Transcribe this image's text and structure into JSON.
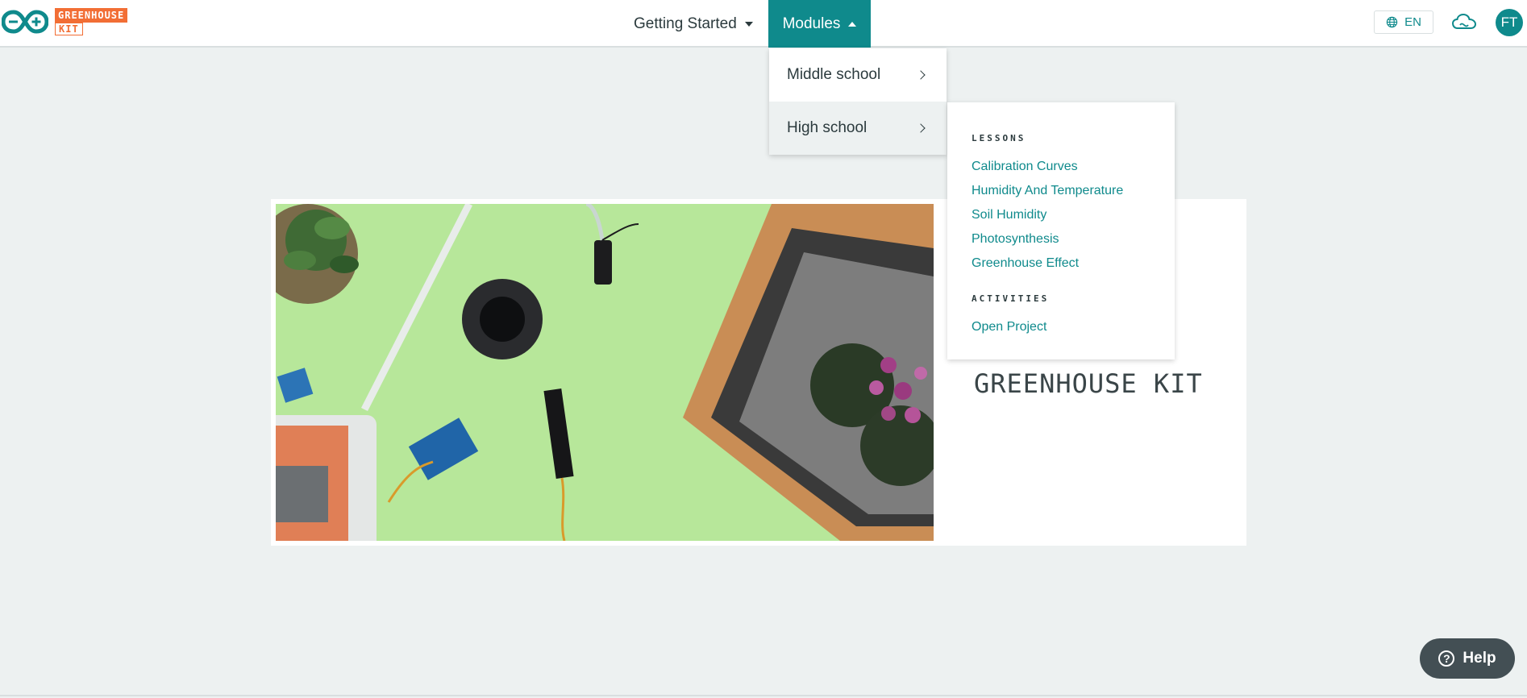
{
  "brand": {
    "logo_top": "GREENHOUSE",
    "logo_bottom": "KIT",
    "accent": "#0f8a8c",
    "logo_color": "#f26e35"
  },
  "nav": {
    "getting_started": "Getting Started",
    "modules": "Modules"
  },
  "header": {
    "language": "EN",
    "avatar_initials": "FT",
    "icons": [
      "globe-icon",
      "cloud-icon"
    ]
  },
  "modules_menu": {
    "items": [
      {
        "label": "Middle school"
      },
      {
        "label": "High school"
      }
    ]
  },
  "high_school_menu": {
    "lessons_label": "LESSONS",
    "lessons": [
      "Calibration Curves",
      "Humidity And Temperature",
      "Soil Humidity",
      "Photosynthesis",
      "Greenhouse Effect"
    ],
    "activities_label": "ACTIVITIES",
    "activities": [
      "Open Project"
    ]
  },
  "hero": {
    "title": "GREENHOUSE KIT"
  },
  "help": {
    "label": "Help"
  }
}
